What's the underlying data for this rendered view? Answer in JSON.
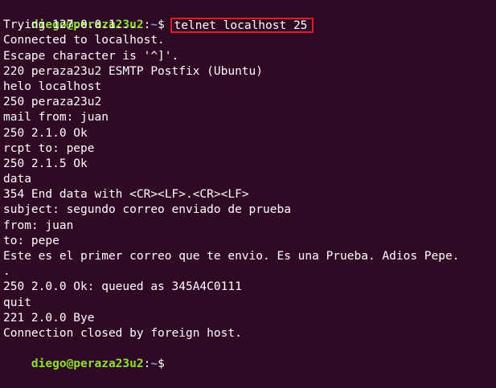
{
  "prompt": {
    "user_host": "diego@peraza23u2",
    "separator": ":",
    "path": "~",
    "symbol": "$ "
  },
  "command": "telnet localhost 25",
  "output_lines": [
    "Trying 127.0.0.1...",
    "Connected to localhost.",
    "Escape character is '^]'.",
    "220 peraza23u2 ESMTP Postfix (Ubuntu)",
    "helo localhost",
    "250 peraza23u2",
    "mail from: juan",
    "250 2.1.0 Ok",
    "rcpt to: pepe",
    "250 2.1.5 Ok",
    "data",
    "354 End data with <CR><LF>.<CR><LF>",
    "subject: segundo correo enviado de prueba",
    "from: juan",
    "to: pepe",
    "Este es el primer correo que te envio. Es una Prueba. Adios Pepe.",
    ".",
    "250 2.0.0 Ok: queued as 345A4C0111",
    "quit",
    "221 2.0.0 Bye",
    "Connection closed by foreign host."
  ],
  "colors": {
    "background": "#300a24",
    "prompt_user": "#8ae234",
    "prompt_path": "#729fcf",
    "highlight_box": "#e01b24"
  }
}
